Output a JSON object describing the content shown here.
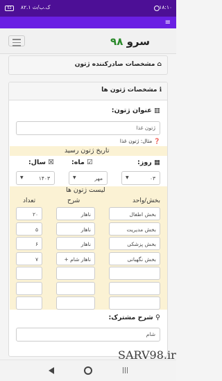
{
  "status_bar": {
    "time": "۱۸:۱۰",
    "network_speed": "۸۲.۱ ک.ب/ث",
    "battery": "52"
  },
  "navbar": {
    "brand_text": "سرو",
    "brand_number": "۹۸"
  },
  "issuer_card": {
    "title": "مشخصات صادرکننده ژتون"
  },
  "tokens_card": {
    "title": "مشخصات ژتون ها",
    "token_title_label": "عنوان ژتون:",
    "token_title_placeholder": "ژتون غذا",
    "example_hint": "مثال: ژتون غذا",
    "receipt_date_caption": "تاریخ ژتون رسید",
    "day_label": "روز:",
    "month_label": "ماه:",
    "year_label": "سال:",
    "day_value": "۰۳",
    "month_value": "مهر",
    "year_value": "۱۴۰۳",
    "list_caption": "لیست ژتون ها",
    "columns": {
      "section": "بخش/واحد",
      "desc": "شرح",
      "count": "تعداد"
    },
    "rows": [
      {
        "section": "بخش اطفال",
        "desc": "ناهار",
        "count": "۲۰"
      },
      {
        "section": "بخش مدیریت",
        "desc": "ناهار",
        "count": "۵"
      },
      {
        "section": "بخش پزشکی",
        "desc": "ناهار",
        "count": "۶"
      },
      {
        "section": "بخش نگهبانی",
        "desc": "ناهار شام +",
        "count": "۷"
      },
      {
        "section": "",
        "desc": "",
        "count": ""
      },
      {
        "section": "",
        "desc": "",
        "count": ""
      },
      {
        "section": "",
        "desc": "",
        "count": ""
      }
    ],
    "common_desc_label": "شرح مشترک:",
    "common_desc_value": "شام"
  },
  "watermark": "SARV98.ir"
}
